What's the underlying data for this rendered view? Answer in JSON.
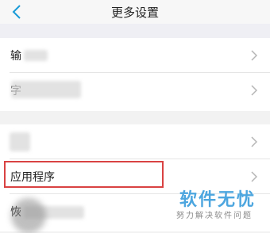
{
  "header": {
    "title": "更多设置",
    "back_icon": "chevron-left-icon"
  },
  "settings_group_1": {
    "items": [
      {
        "label": "输"
      },
      {
        "label": "字"
      }
    ]
  },
  "settings_group_2": {
    "items": [
      {
        "label": ""
      },
      {
        "label": "应用程序"
      },
      {
        "label": "恢"
      }
    ]
  },
  "watermark": {
    "title": "软件无忧",
    "subtitle": "努力解决软件问题"
  },
  "colors": {
    "accent": "#1a9bd7",
    "highlight_border": "#d94242",
    "watermark": "#4da6df"
  }
}
